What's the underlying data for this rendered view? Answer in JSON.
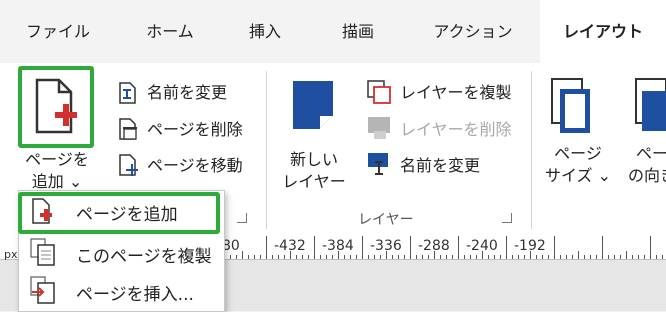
{
  "tabs": [
    "ファイル",
    "ホーム",
    "挿入",
    "描画",
    "アクション",
    "レイアウト"
  ],
  "page_group": {
    "add_page_label_1": "ページを",
    "add_page_label_2": "追加 ⌄",
    "rename": "名前を変更",
    "delete_page": "ページを削除",
    "move_page": "ページを移動"
  },
  "layer_group": {
    "new_layer_1": "新しい",
    "new_layer_2": "レイヤー",
    "duplicate": "レイヤーを複製",
    "delete": "レイヤーを削除",
    "rename": "名前を変更",
    "title": "レイヤー"
  },
  "size_group": {
    "page_size_1": "ページ",
    "page_size_2": "サイズ ⌄",
    "orientation_1": "ペー",
    "orientation_2": "の向き"
  },
  "ruler": {
    "unit": "px",
    "labels": [
      "80",
      "-432",
      "-384",
      "-336",
      "-288",
      "-240",
      "-192"
    ]
  },
  "dropdown": {
    "items": [
      "ページを追加",
      "このページを複製",
      "ページを挿入..."
    ]
  },
  "colors": {
    "accent_red": "#d22f2f",
    "highlight": "#2eaa3a",
    "icon_blue": "#1f4fa0"
  }
}
